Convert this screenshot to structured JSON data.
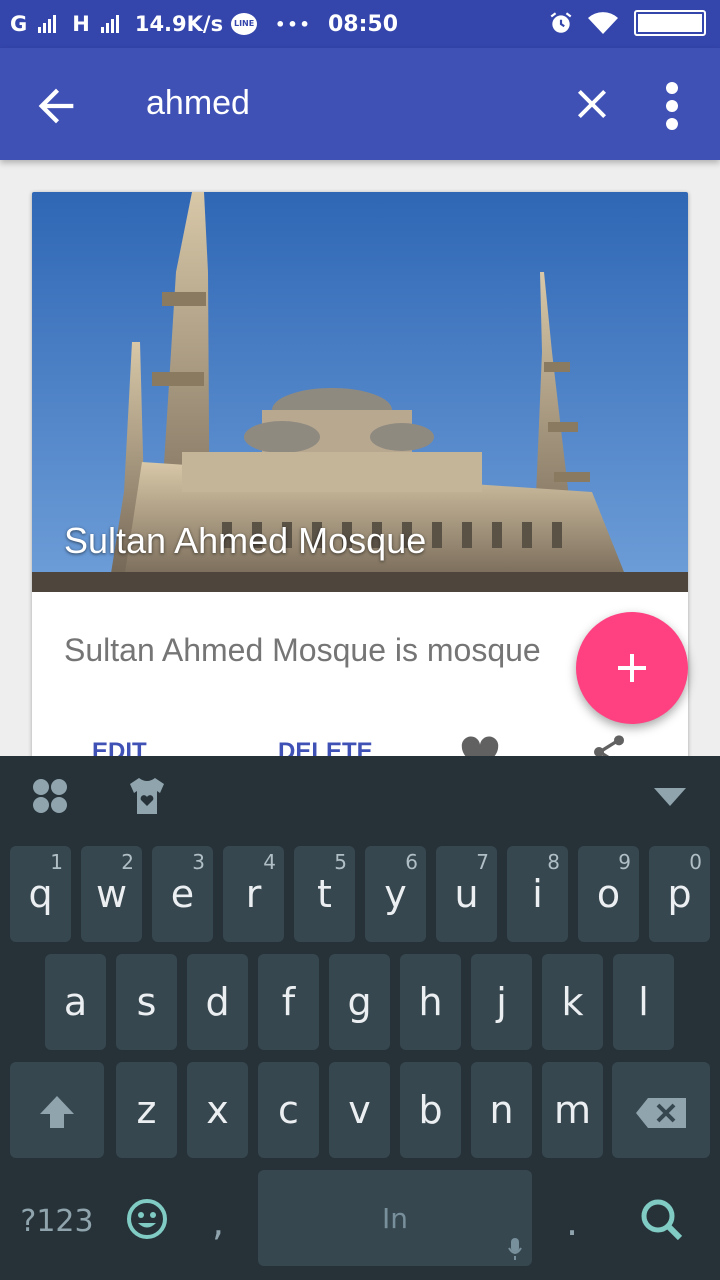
{
  "status_bar": {
    "carrier1": "G",
    "carrier2": "H",
    "speed": "14.9K/s",
    "line_badge": "LINE",
    "dots": "•••",
    "time": "08:50"
  },
  "app_bar": {
    "search_text": "ahmed"
  },
  "card": {
    "title": "Sultan Ahmed Mosque",
    "description": "Sultan Ahmed Mosque is mosque",
    "edit_label": "EDIT",
    "delete_label": "DELETE"
  },
  "fab": {
    "icon": "plus-icon"
  },
  "keyboard": {
    "row1": [
      {
        "k": "q",
        "n": "1"
      },
      {
        "k": "w",
        "n": "2"
      },
      {
        "k": "e",
        "n": "3"
      },
      {
        "k": "r",
        "n": "4"
      },
      {
        "k": "t",
        "n": "5"
      },
      {
        "k": "y",
        "n": "6"
      },
      {
        "k": "u",
        "n": "7"
      },
      {
        "k": "i",
        "n": "8"
      },
      {
        "k": "o",
        "n": "9"
      },
      {
        "k": "p",
        "n": "0"
      }
    ],
    "row2": [
      "a",
      "s",
      "d",
      "f",
      "g",
      "h",
      "j",
      "k",
      "l"
    ],
    "row3": [
      "z",
      "x",
      "c",
      "v",
      "b",
      "n",
      "m"
    ],
    "symbols_label": "?123",
    "comma": ",",
    "period": ".",
    "space_label": "In"
  },
  "colors": {
    "primary": "#3f51b5",
    "status_bar": "#3445ac",
    "accent": "#ff4081",
    "keyboard_bg": "#263238",
    "key_bg": "#37474f",
    "keyboard_accent": "#80cbc4"
  }
}
